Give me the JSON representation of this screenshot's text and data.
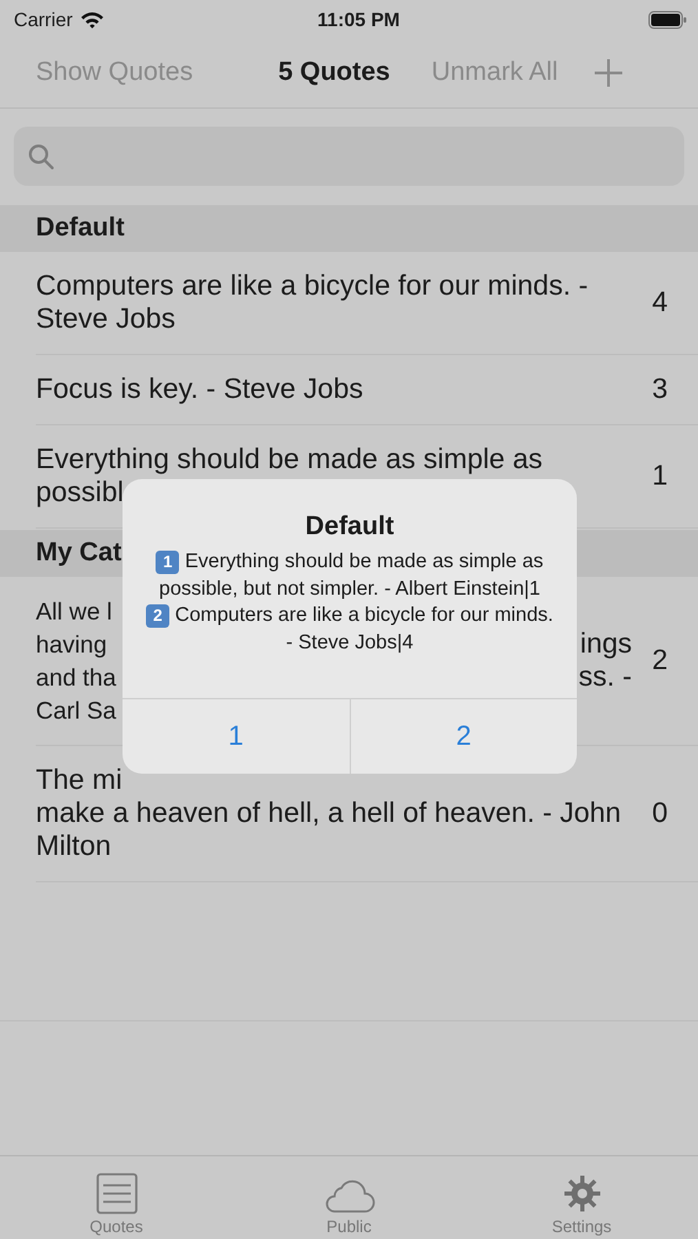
{
  "status_bar": {
    "carrier": "Carrier",
    "time": "11:05 PM"
  },
  "nav": {
    "left": "Show Quotes",
    "title": "5 Quotes",
    "right": "Unmark All"
  },
  "sections": [
    {
      "header": "Default",
      "rows": [
        {
          "kind": "full",
          "text": "Computers are like a bicycle for our minds. - Steve Jobs",
          "count": "4"
        },
        {
          "kind": "full",
          "text": "Focus is key. - Steve Jobs",
          "count": "3"
        },
        {
          "kind": "full",
          "text": "Everything should be made as simple as possibl",
          "count": "1"
        }
      ]
    },
    {
      "header": "My Cat",
      "rows": [
        {
          "kind": "split",
          "left": [
            "All we l",
            "having",
            "and tha",
            "Carl Sa"
          ],
          "right": [
            "ings",
            "ss. -"
          ],
          "count": "2"
        },
        {
          "kind": "partial",
          "top": "The mi",
          "text": "make a heaven of hell, a hell of heaven. - John Milton",
          "count": "0"
        }
      ]
    }
  ],
  "alert": {
    "title": "Default",
    "items": [
      {
        "badge": "1",
        "text": "Everything should be made as simple as possible, but not simpler. - Albert Einstein|1"
      },
      {
        "badge": "2",
        "text": "Computers are like a bicycle for our minds. - Steve Jobs|4"
      }
    ],
    "buttons": [
      "1",
      "2"
    ]
  },
  "tabs": [
    {
      "label": "Quotes"
    },
    {
      "label": "Public"
    },
    {
      "label": "Settings"
    }
  ]
}
